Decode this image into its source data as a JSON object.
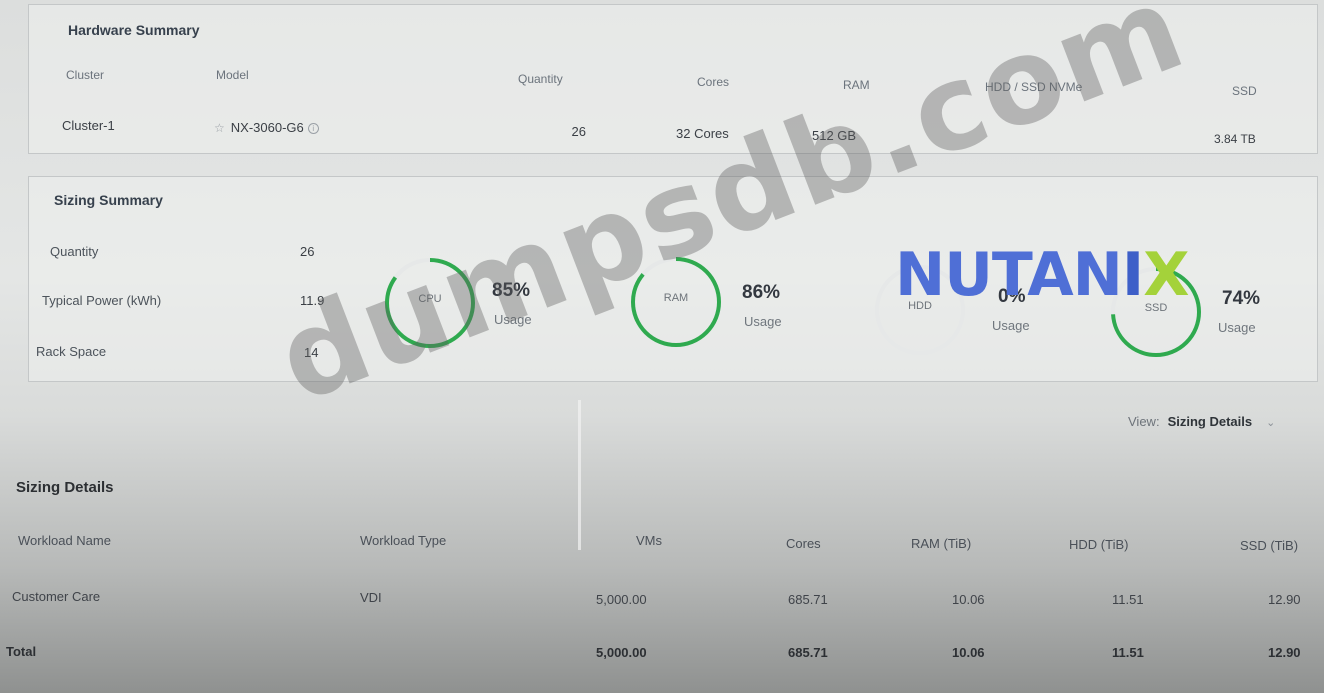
{
  "hardware_summary": {
    "title": "Hardware Summary",
    "headers": {
      "cluster": "Cluster",
      "model": "Model",
      "quantity": "Quantity",
      "cores": "Cores",
      "ram": "RAM",
      "hdd_ssd_nvme": "HDD / SSD NVMe",
      "ssd": "SSD"
    },
    "row": {
      "cluster": "Cluster-1",
      "model": "NX-3060-G6",
      "quantity": "26",
      "cores": "32 Cores",
      "ram": "512 GB",
      "hdd_ssd_nvme": "",
      "ssd": "3.84 TB"
    }
  },
  "sizing_summary": {
    "title": "Sizing Summary",
    "stats": [
      {
        "label": "Quantity",
        "value": "26"
      },
      {
        "label": "Typical Power (kWh)",
        "value": "11.9"
      },
      {
        "label": "Rack Space",
        "value": "14"
      }
    ],
    "gauges": [
      {
        "label": "CPU",
        "percent_text": "85%",
        "usage_label": "Usage",
        "fraction": 0.85,
        "color": "#2faa4f"
      },
      {
        "label": "RAM",
        "percent_text": "86%",
        "usage_label": "Usage",
        "fraction": 0.86,
        "color": "#2faa4f"
      },
      {
        "label": "HDD",
        "percent_text": "0%",
        "usage_label": "Usage",
        "fraction": 0.0,
        "color": "#2faa4f"
      },
      {
        "label": "SSD",
        "percent_text": "74%",
        "usage_label": "Usage",
        "fraction": 0.74,
        "color": "#2faa4f"
      }
    ]
  },
  "view": {
    "label": "View:",
    "selected": "Sizing Details"
  },
  "sizing_details": {
    "title": "Sizing Details",
    "headers": [
      "Workload Name",
      "Workload Type",
      "VMs",
      "Cores",
      "RAM (TiB)",
      "HDD (TiB)",
      "SSD (TiB)"
    ],
    "rows": [
      [
        "Customer Care",
        "VDI",
        "5,000.00",
        "685.71",
        "10.06",
        "11.51",
        "12.90"
      ]
    ],
    "total": [
      "Total",
      "",
      "5,000.00",
      "685.71",
      "10.06",
      "11.51",
      "12.90"
    ]
  },
  "watermark": "dumpsdb.com",
  "brand_logo": "NUTANIX",
  "colors": {
    "gauge_green": "#2faa4f",
    "gauge_track": "#e6e8e8",
    "brand_blue": "#4f6fd6",
    "brand_green": "#a4d23a"
  }
}
